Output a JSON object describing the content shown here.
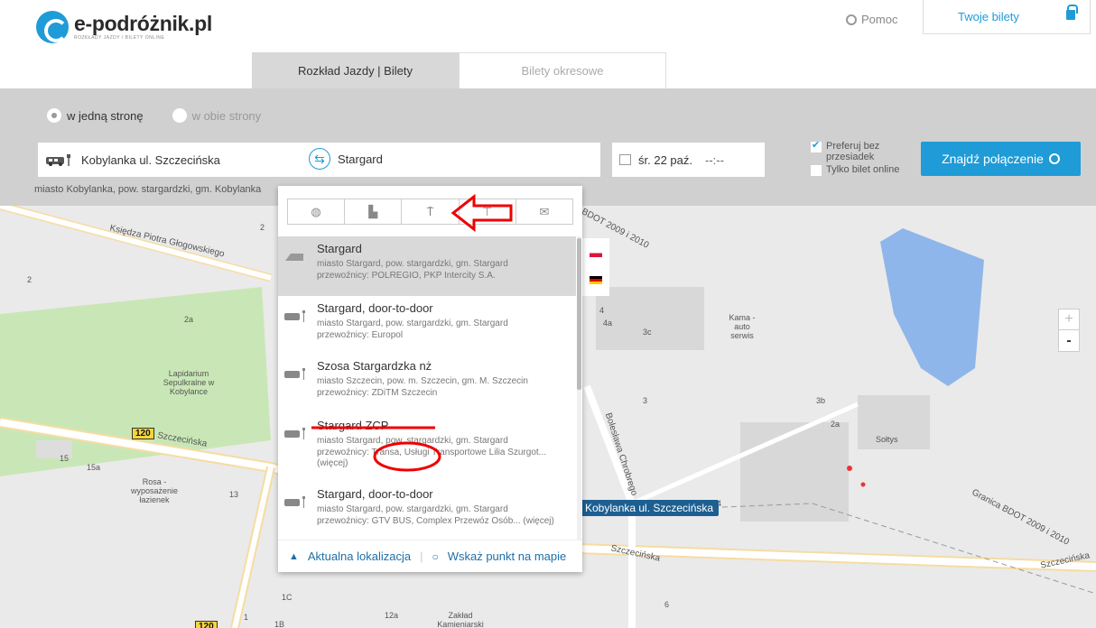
{
  "header": {
    "logo_main": "e-podróżnik.pl",
    "logo_sub": "ROZKŁADY JAZDY / BILETY ONLINE",
    "help": "Pomoc",
    "tickets": "Twoje bilety"
  },
  "tabs": [
    "Rozkład Jazdy | Bilety",
    "Bilety okresowe"
  ],
  "search": {
    "one_way": "w jedną stronę",
    "two_way": "w obie strony",
    "from": "Kobylanka ul. Szczecińska",
    "to": "Stargard",
    "from_hint": "miasto Kobylanka, pow. stargardzki, gm. Kobylanka",
    "date": "śr. 22 paź.",
    "time": "--:--",
    "prefer_direct": "Preferuj bez przesiadek",
    "online_only": "Tylko bilet online",
    "find_button": "Znajdź połączenie"
  },
  "dropdown": {
    "tab_icons": [
      "globe-icon",
      "building-icon",
      "stop-post-icon",
      "signpost-icon",
      "envelope-icon"
    ],
    "items": [
      {
        "name": "Stargard",
        "line1": "miasto Stargard, pow. stargardzki, gm. Stargard",
        "line2": "przewoźnicy: POLREGIO, PKP Intercity S.A.",
        "line3": ""
      },
      {
        "name": "Stargard, door-to-door",
        "line1": "miasto Stargard, pow. stargardzki, gm. Stargard",
        "line2": "przewoźnicy: Europol",
        "line3": ""
      },
      {
        "name": "Szosa Stargardzka nż",
        "line1": "miasto Szczecin, pow. m. Szczecin, gm. M. Szczecin",
        "line2": "przewoźnicy: ZDiTM Szczecin",
        "line3": ""
      },
      {
        "name": "Stargard ZCP",
        "line1": "miasto Stargard, pow. stargardzki, gm. Stargard",
        "line2": "przewoźnicy: Transa, Usługi Transportowe Lilia Szurgot...",
        "line3": "(więcej)"
      },
      {
        "name": "Stargard, door-to-door",
        "line1": "miasto Stargard, pow. stargardzki, gm. Stargard",
        "line2": "przewoźnicy: GTV BUS, Complex Przewóz Osób... (więcej)",
        "line3": ""
      }
    ],
    "current_location": "Aktualna lokalizacja",
    "pick_on_map": "Wskaż punkt na mapie"
  },
  "map": {
    "stop_label": "Kobylanka ul. Szczecińska",
    "zoom_in": "+",
    "zoom_out": "-",
    "streets": [
      "Księdza Piotra Głogowskiego",
      "Szczecińska",
      "Bolesława Chrobrego",
      "Szczecińska",
      "Granica BDOT 2009 i 2010",
      "BDOT 2009 i 2010",
      "Szczecińska"
    ],
    "places": [
      "Lapidarium Sepulkralne w Kobylance",
      "Rosa - wyposażenie łazienek",
      "Kama - auto serwis",
      "Sołtys",
      "Zakład Kamieniarski"
    ],
    "road_number": "120",
    "house_numbers": [
      "2",
      "3",
      "2a",
      "4",
      "4a",
      "3c",
      "3",
      "3b",
      "2a",
      "15",
      "15a",
      "13",
      "4",
      "1C",
      "1",
      "1B",
      "12a",
      "6"
    ]
  }
}
